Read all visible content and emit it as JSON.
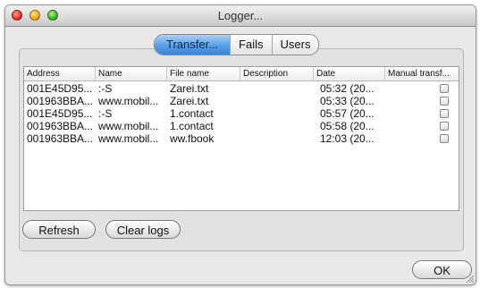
{
  "window": {
    "title": "Logger..."
  },
  "tabs": [
    {
      "label": "Transfer...",
      "active": true
    },
    {
      "label": "Fails",
      "active": false
    },
    {
      "label": "Users",
      "active": false
    }
  ],
  "table": {
    "columns": [
      "Address",
      "Name",
      "File name",
      "Description",
      "Date",
      "Manual transf..."
    ],
    "rows": [
      {
        "address": "001E45D95...",
        "name": ":-S",
        "file_name": "Zarei.txt",
        "description": "",
        "date": "05:32 (20...",
        "manual": false
      },
      {
        "address": "001963BBA...",
        "name": "www.mobil...",
        "file_name": "Zarei.txt",
        "description": "",
        "date": "05:33 (20...",
        "manual": false
      },
      {
        "address": "001E45D95...",
        "name": ":-S",
        "file_name": "1.contact",
        "description": "",
        "date": "05:57 (20...",
        "manual": false
      },
      {
        "address": "001963BBA...",
        "name": "www.mobil...",
        "file_name": "1.contact",
        "description": "",
        "date": "05:58 (20...",
        "manual": false
      },
      {
        "address": "001963BBA...",
        "name": "www.mobil...",
        "file_name": "ww.fbook",
        "description": "",
        "date": "12:03 (20...",
        "manual": false
      }
    ]
  },
  "buttons": {
    "refresh": "Refresh",
    "clear_logs": "Clear logs",
    "ok": "OK"
  },
  "colors": {
    "active_tab": "#5a9fe6",
    "close": "#e0342a",
    "minimize": "#f0a81c",
    "zoom": "#3fb429"
  }
}
